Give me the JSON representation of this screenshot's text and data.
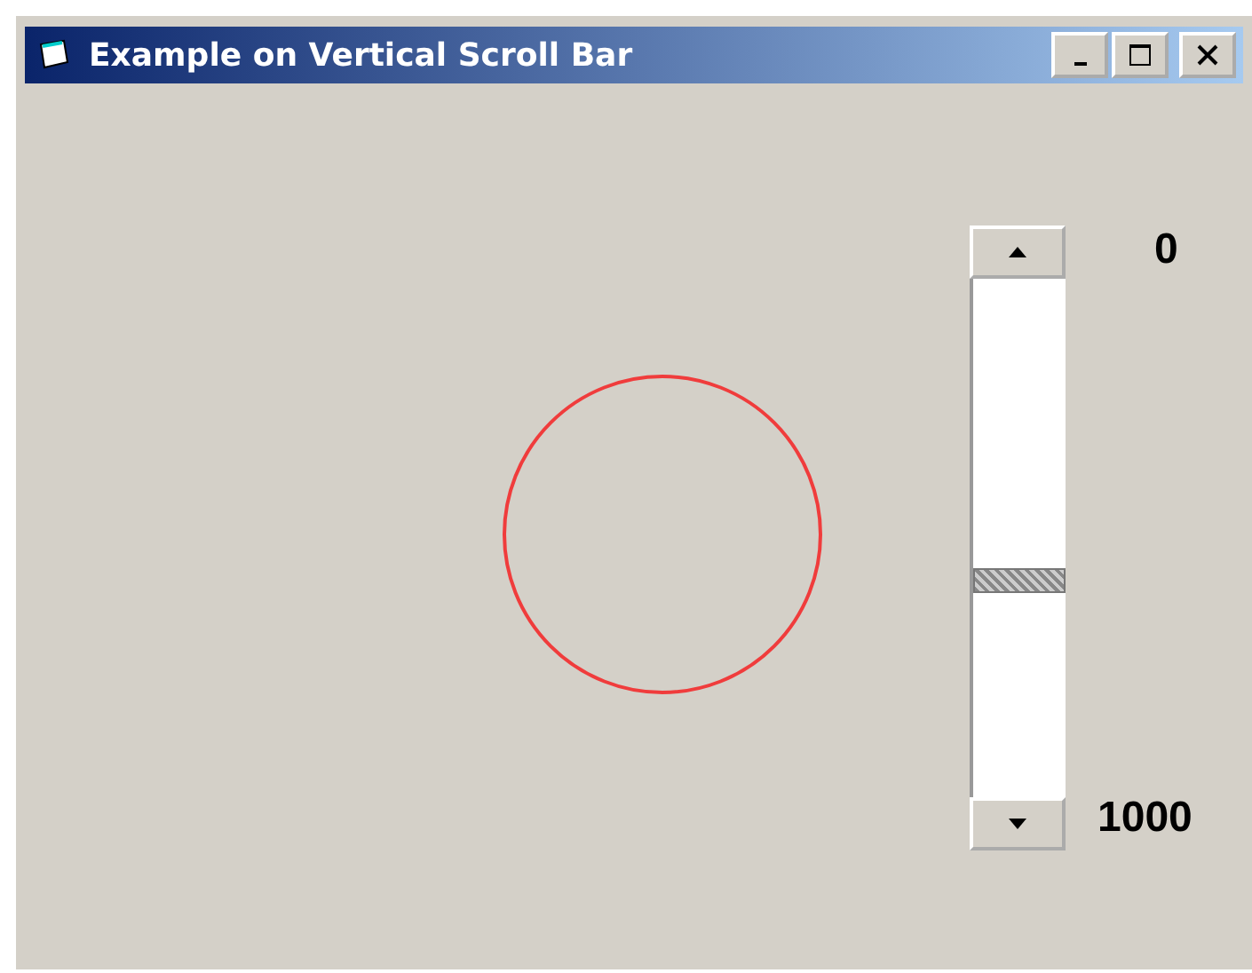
{
  "window": {
    "title": "Example on Vertical Scroll Bar"
  },
  "labels": {
    "min": "0",
    "max": "1000"
  }
}
